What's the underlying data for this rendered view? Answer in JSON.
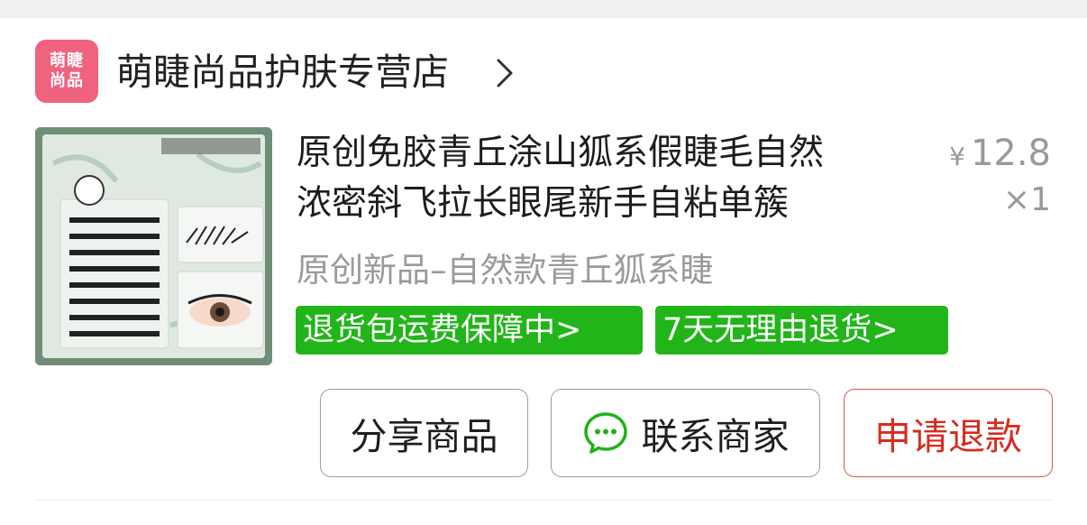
{
  "store": {
    "logo_line1": "萌睫",
    "logo_line2": "尚品",
    "name": "萌睫尚品护肤专营店"
  },
  "product": {
    "title_line1": "原创免胶青丘涂山狐系假睫毛自然",
    "title_line2": "浓密斜飞拉长眼尾新手自粘单簇",
    "currency": "¥",
    "price": "12.8",
    "quantity": "×1",
    "variant": "原创新品–自然款青丘狐系睫"
  },
  "badges": [
    "退货包运费保障中>",
    "7天无理由退货>"
  ],
  "actions": {
    "share": "分享商品",
    "contact": "联系商家",
    "refund": "申请退款"
  },
  "colors": {
    "badge_green": "#22b51a",
    "refund_red": "#d72b20",
    "logo_pink": "#f0637f"
  },
  "icons": {
    "store_chevron": "chevron-right-icon",
    "contact": "wechat-chat-icon"
  }
}
